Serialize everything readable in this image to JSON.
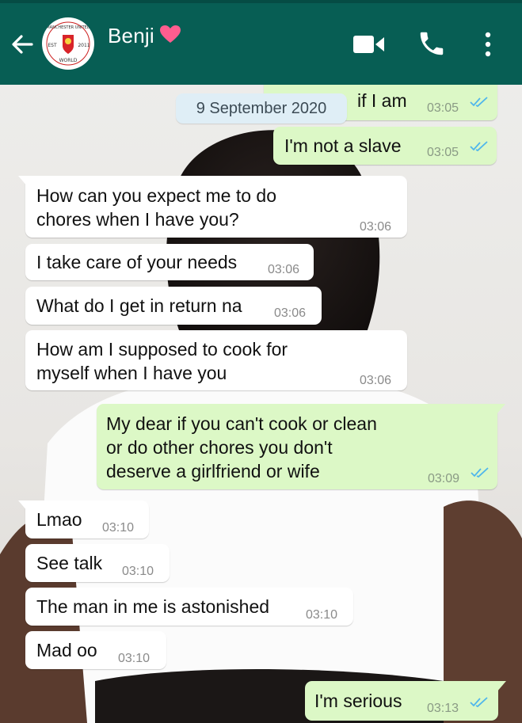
{
  "header": {
    "contact_name": "Benji",
    "avatar_text": {
      "top": "MANCHESTER UNITED",
      "left": "EST",
      "right": "2011",
      "bottom": "WORLD"
    },
    "colors": {
      "bar": "#075e54",
      "heart": "#ff5d8f"
    },
    "icons": [
      "back-arrow-icon",
      "heart-icon",
      "video-call-icon",
      "phone-icon",
      "more-options-icon"
    ]
  },
  "date_separator": "9 September 2020",
  "messages": [
    {
      "dir": "out",
      "text": "if I am",
      "time": "03:05",
      "read": true,
      "partial": true
    },
    {
      "dir": "out",
      "text": "I'm not a slave",
      "time": "03:05",
      "read": true
    },
    {
      "dir": "in",
      "lines": [
        "How can you expect me to do",
        "chores when I have you?"
      ],
      "time": "03:06"
    },
    {
      "dir": "in",
      "text": "I take care of your needs",
      "time": "03:06"
    },
    {
      "dir": "in",
      "text": "What do I get in return na",
      "time": "03:06"
    },
    {
      "dir": "in",
      "lines": [
        "How am I supposed to cook for",
        "myself when I have you"
      ],
      "time": "03:06"
    },
    {
      "dir": "out",
      "lines": [
        "My dear if you can't cook or clean",
        "or do other chores you don't",
        "deserve a girlfriend or wife"
      ],
      "time": "03:09",
      "read": true
    },
    {
      "dir": "in",
      "text": "Lmao",
      "time": "03:10"
    },
    {
      "dir": "in",
      "text": "See talk",
      "time": "03:10"
    },
    {
      "dir": "in",
      "text": "The man in me is astonished",
      "time": "03:10"
    },
    {
      "dir": "in",
      "text": "Mad oo",
      "time": "03:10"
    },
    {
      "dir": "out",
      "text": "I'm serious",
      "time": "03:13",
      "read": true
    }
  ],
  "colors": {
    "incoming": "#ffffff",
    "outgoing": "#dcf8c6",
    "read_ticks": "#4fb6ec"
  }
}
